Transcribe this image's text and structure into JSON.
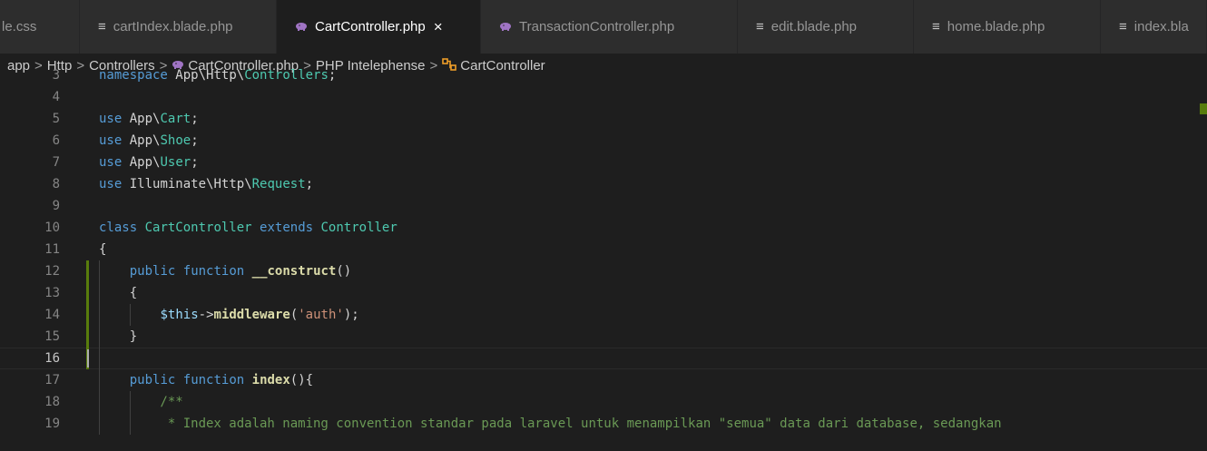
{
  "tabs": [
    {
      "label": "le.css",
      "icon": "none",
      "active": false
    },
    {
      "label": "cartIndex.blade.php",
      "icon": "lines-icon",
      "active": false
    },
    {
      "label": "CartController.php",
      "icon": "php-elephant-icon",
      "active": true,
      "close": "×"
    },
    {
      "label": "TransactionController.php",
      "icon": "php-elephant-icon",
      "active": false
    },
    {
      "label": "edit.blade.php",
      "icon": "lines-icon",
      "active": false
    },
    {
      "label": "home.blade.php",
      "icon": "lines-icon",
      "active": false
    },
    {
      "label": "index.bla",
      "icon": "lines-icon",
      "active": false
    }
  ],
  "breadcrumb": {
    "parts": [
      "app",
      "Http",
      "Controllers",
      "CartController.php",
      "PHP Intelephense",
      "CartController"
    ],
    "separator": ">"
  },
  "editor": {
    "current_line": "16",
    "lines": [
      {
        "num": "3",
        "text": "namespace App\\Http\\Controllers;"
      },
      {
        "num": "4",
        "text": ""
      },
      {
        "num": "5",
        "text": "use App\\Cart;"
      },
      {
        "num": "6",
        "text": "use App\\Shoe;"
      },
      {
        "num": "7",
        "text": "use App\\User;"
      },
      {
        "num": "8",
        "text": "use Illuminate\\Http\\Request;"
      },
      {
        "num": "9",
        "text": ""
      },
      {
        "num": "10",
        "text": "class CartController extends Controller"
      },
      {
        "num": "11",
        "text": "{"
      },
      {
        "num": "12",
        "text": "    public function __construct()"
      },
      {
        "num": "13",
        "text": "    {"
      },
      {
        "num": "14",
        "text": "        $this->middleware('auth');"
      },
      {
        "num": "15",
        "text": "    }"
      },
      {
        "num": "16",
        "text": ""
      },
      {
        "num": "17",
        "text": "    public function index(){"
      },
      {
        "num": "18",
        "text": "        /**"
      },
      {
        "num": "19",
        "text": "         * Index adalah naming convention standar pada laravel untuk menampilkan \"semua\" data dari database, sedangkan"
      }
    ]
  },
  "colors": {
    "editor_bg": "#1e1e1e",
    "tab_bg": "#2d2d2d",
    "keyword": "#569cd6",
    "class": "#4ec9b0",
    "function": "#dcdcaa",
    "variable": "#9cdcfe",
    "string": "#ce9178",
    "comment": "#6a9955",
    "git_modified": "#587c0c"
  }
}
